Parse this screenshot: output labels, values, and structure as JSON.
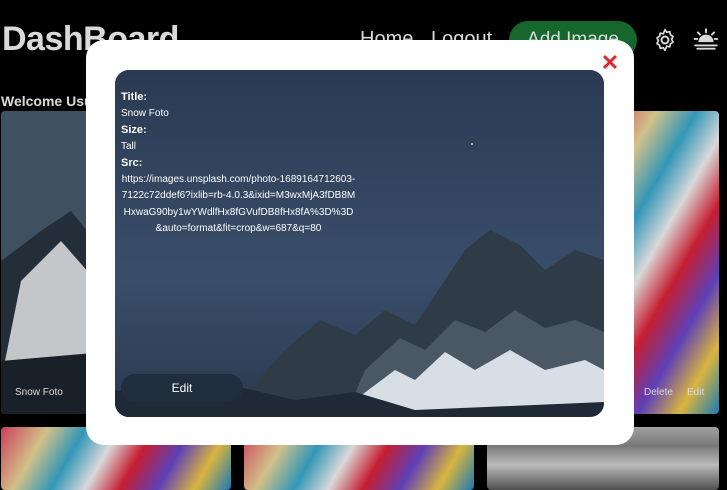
{
  "header": {
    "brand": "DashBoard",
    "nav": {
      "home": "Home",
      "logout": "Logout"
    },
    "add_image": "Add Image",
    "icons": {
      "settings": "gear-icon",
      "theme": "sun-icon"
    }
  },
  "welcome": "Welcome Usua",
  "gallery": {
    "cards": [
      {
        "label": "Snow Foto"
      },
      {
        "delete": "Delete",
        "edit": "Edit"
      }
    ]
  },
  "modal": {
    "close": "✕",
    "title_label": "Title:",
    "title_value": "Snow Foto",
    "size_label": "Size:",
    "size_value": "Tall",
    "src_label": "Src:",
    "src_value": "https://images.unsplash.com/photo-1689164712603-7122c72ddef6?ixlib=rb-4.0.3&ixid=M3wxMjA3fDB8MHxwaG90by1wYWdlfHx8fGVufDB8fHx8fA%3D%3D&auto=format&fit=crop&w=687&q=80",
    "edit": "Edit"
  },
  "colors": {
    "accent": "#1a7a36",
    "close": "#e0292e",
    "edit_bg": "#1f2d3d"
  }
}
